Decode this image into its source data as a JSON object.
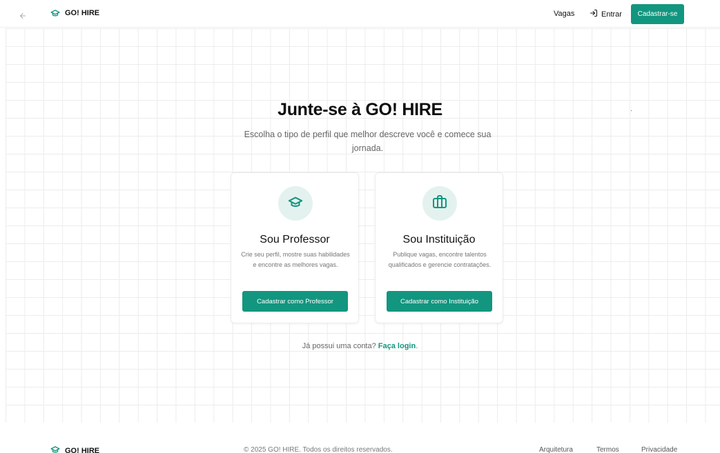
{
  "header": {
    "brand": "GO! HIRE",
    "nav_vagas": "Vagas",
    "nav_entrar": "Entrar",
    "cta_cadastrar": "Cadastrar-se",
    "icons": {
      "back": "arrow-left-icon",
      "brand": "graduation-cap-icon",
      "entrar": "login-icon"
    }
  },
  "hero": {
    "title": "Junte-se à GO! HIRE",
    "subtitle": "Escolha o tipo de perfil que melhor descreve você e comece sua jornada."
  },
  "cards": [
    {
      "icon": "graduation-cap-icon",
      "title": "Sou Professor",
      "description": "Crie seu perfil, mostre suas habilidades e encontre as melhores vagas.",
      "button": "Cadastrar como Professor"
    },
    {
      "icon": "briefcase-icon",
      "title": "Sou Instituição",
      "description": "Publique vagas, encontre talentos qualificados e gerencie contratações.",
      "button": "Cadastrar como Instituição"
    }
  ],
  "login_prompt": {
    "text": "Já possui uma conta?",
    "link": "Faça login",
    "suffix": "."
  },
  "footer": {
    "brand": "GO! HIRE",
    "copyright": "© 2025 GO! HIRE. Todos os direitos reservados.",
    "links": [
      "Arquitetura",
      "Termos",
      "Privacidade"
    ]
  },
  "colors": {
    "accent": "#12967f",
    "icon_bg": "#e3f2ef",
    "grid_line": "#ececec"
  }
}
